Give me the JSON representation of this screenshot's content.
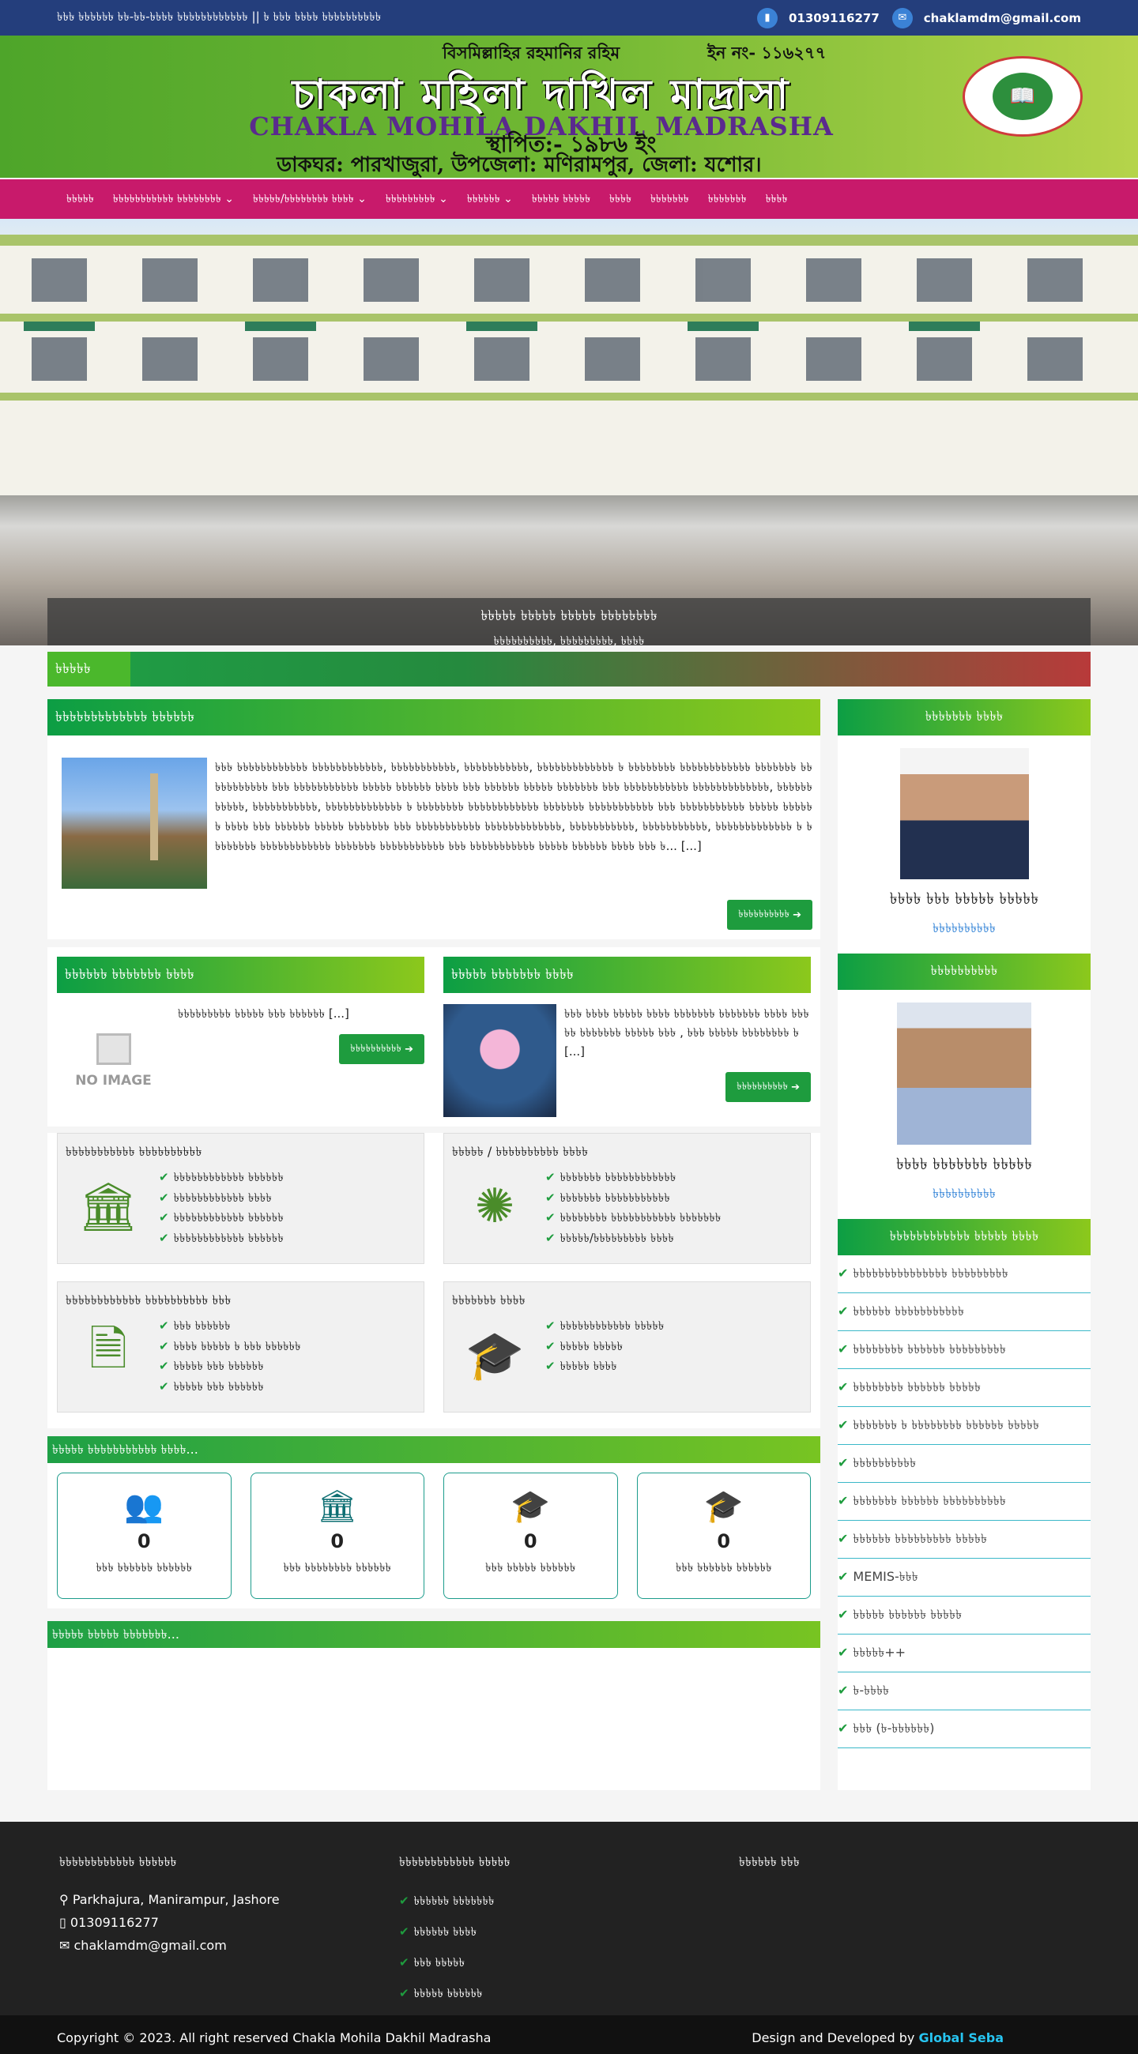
{
  "topbar": {
    "marquee": "৳৳৳ ৳৳৳৳৳৳ ৳৳-৳৳-৳৳৳৳ ৳৳৳৳৳৳৳৳৳৳৳৳ || ৳ ৳৳৳ ৳৳৳৳ ৳৳৳৳৳৳৳৳৳৳",
    "phone": "01309116277",
    "email": "chaklamdm@gmail.com",
    "phone_icon": "mobile-icon",
    "email_icon": "envelope-icon"
  },
  "header": {
    "bismillah": "বিসমিল্লাহির রহমানির রহিম",
    "eiin": "ইন নং- ১১৬২৭৭",
    "name_bn": "চাকলা মহিলা দাখিল মাদ্রাসা",
    "name_en": "CHAKLA MOHILA DAKHIL MADRASHA",
    "established": "স্থাপিত:- ১৯৮৬ ইং",
    "address": "ডাকঘর: পারখাজুরা, উপজেলা: মণিরামপুর, জেলা: যশোর।"
  },
  "nav": {
    "items": [
      {
        "label": "৳৳৳৳৳",
        "dropdown": false
      },
      {
        "label": "৳৳৳৳৳৳৳৳৳৳৳ ৳৳৳৳৳৳৳৳",
        "dropdown": true
      },
      {
        "label": "৳৳৳৳৳/৳৳৳৳৳৳৳৳ ৳৳৳৳",
        "dropdown": true
      },
      {
        "label": "৳৳৳৳৳৳৳৳৳",
        "dropdown": true
      },
      {
        "label": "৳৳৳৳৳৳",
        "dropdown": true
      },
      {
        "label": "৳৳৳৳৳ ৳৳৳৳৳",
        "dropdown": false
      },
      {
        "label": "৳৳৳৳",
        "dropdown": false
      },
      {
        "label": "৳৳৳৳৳৳৳",
        "dropdown": false
      },
      {
        "label": "৳৳৳৳৳৳৳",
        "dropdown": false
      },
      {
        "label": "৳৳৳৳",
        "dropdown": false
      }
    ]
  },
  "banner": {
    "caption_title": "৳৳৳৳৳ ৳৳৳৳৳ ৳৳৳৳৳ ৳৳৳৳৳৳৳৳",
    "caption_sub": "৳৳৳৳৳৳৳৳৳৳, ৳৳৳৳৳৳৳৳৳, ৳৳৳৳"
  },
  "notice": {
    "label": "৳৳৳৳৳"
  },
  "intro": {
    "title": "৳৳৳৳৳৳৳৳৳৳৳৳৳ ৳৳৳৳৳৳",
    "text": "৳৳৳ ৳৳৳৳৳৳৳৳৳৳৳৳ ৳৳৳৳৳৳৳৳৳৳৳৳, ৳৳৳৳৳৳৳৳৳৳৳, ৳৳৳৳৳৳৳৳৳৳৳, ৳৳৳৳৳৳৳৳৳৳৳৳৳ ৳ ৳৳৳৳৳৳৳৳ ৳৳৳৳৳৳৳৳৳৳৳৳ ৳৳৳৳৳৳৳ ৳৳৳৳৳৳৳৳৳৳৳ ৳৳৳ ৳৳৳৳৳৳৳৳৳৳৳ ৳৳৳৳৳ ৳৳৳৳৳৳ ৳৳৳৳ ৳৳৳ ৳৳৳৳৳৳ ৳৳৳৳৳ ৳৳৳৳৳৳৳ ৳৳৳ ৳৳৳৳৳৳৳৳৳৳৳ ৳৳৳৳৳৳৳৳৳৳৳৳৳, ৳৳৳৳৳৳৳৳৳৳৳, ৳৳৳৳৳৳৳৳৳৳৳, ৳৳৳৳৳৳৳৳৳৳৳৳৳ ৳ ৳৳৳৳৳৳৳৳ ৳৳৳৳৳৳৳৳৳৳৳৳ ৳৳৳৳৳৳৳ ৳৳৳৳৳৳৳৳৳৳৳ ৳৳৳ ৳৳৳৳৳৳৳৳৳৳৳ ৳৳৳৳৳ ৳৳৳৳৳৳ ৳৳৳৳ ৳৳৳ ৳৳৳৳৳৳ ৳৳৳৳৳ ৳৳৳৳৳৳৳ ৳৳৳ ৳৳৳৳৳৳৳৳৳৳৳ ৳৳৳৳৳৳৳৳৳৳৳৳৳, ৳৳৳৳৳৳৳৳৳৳৳, ৳৳৳৳৳৳৳৳৳৳৳, ৳৳৳৳৳৳৳৳৳৳৳৳৳ ৳ ৳৳৳৳৳৳৳৳ ৳৳৳৳৳৳৳৳৳৳৳৳ ৳৳৳৳৳৳৳ ৳৳৳৳৳৳৳৳৳৳৳ ৳৳৳ ৳৳৳৳৳৳৳৳৳৳৳ ৳৳৳৳৳ ৳৳৳৳৳৳ ৳৳৳৳ ৳৳৳ ৳... [...]",
    "more": "৳৳৳৳৳৳৳৳৳৳"
  },
  "chair_msg": {
    "title": "৳৳৳৳৳৳ ৳৳৳৳৳৳৳ ৳৳৳৳",
    "text": "৳৳৳৳৳৳৳৳৳ ৳৳৳৳৳ ৳৳৳ ৳৳৳৳৳৳ [...]",
    "no_image": "NO IMAGE",
    "more": "৳৳৳৳৳৳৳৳৳৳"
  },
  "head_msg": {
    "title": "৳৳৳৳৳ ৳৳৳৳৳৳৳ ৳৳৳৳",
    "text": "৳৳৳ ৳৳৳৳ ৳৳৳৳৳ ৳৳৳৳ ৳৳৳৳৳৳৳ ৳৳৳৳৳৳৳ ৳৳৳৳ ৳৳৳৳৳ ৳৳৳৳৳৳৳ ৳৳৳৳৳ ৳৳৳ , ৳৳৳ ৳৳৳৳৳ ৳৳৳৳৳৳৳৳ ৳ [...]",
    "more": "৳৳৳৳৳৳৳৳৳৳"
  },
  "boxes": [
    {
      "title": "৳৳৳৳৳৳৳৳৳৳৳ ৳৳৳৳৳৳৳৳৳৳",
      "icon": "institution-icon",
      "items": [
        "৳৳৳৳৳৳৳৳৳৳৳৳ ৳৳৳৳৳৳",
        "৳৳৳৳৳৳৳৳৳৳৳৳ ৳৳৳৳",
        "৳৳৳৳৳৳৳৳৳৳৳৳ ৳৳৳৳৳৳",
        "৳৳৳৳৳৳৳৳৳৳৳৳ ৳৳৳৳৳৳"
      ]
    },
    {
      "title": "৳৳৳৳৳ / ৳৳৳৳৳৳৳৳৳৳ ৳৳৳৳",
      "icon": "colorful-burst-icon",
      "items": [
        "৳৳৳৳৳৳৳ ৳৳৳৳৳৳৳৳৳৳৳৳",
        "৳৳৳৳৳৳৳ ৳৳৳৳৳৳৳৳৳৳৳",
        "৳৳৳৳৳৳৳৳ ৳৳৳৳৳৳৳৳৳৳৳ ৳৳৳৳৳৳৳",
        "৳৳৳৳৳/৳৳৳৳৳৳৳৳৳ ৳৳৳৳"
      ]
    },
    {
      "title": "৳৳৳৳৳৳৳৳৳৳৳৳ ৳৳৳৳৳৳৳৳৳৳ ৳৳৳",
      "icon": "documents-icon",
      "items": [
        "৳৳৳ ৳৳৳৳৳৳",
        "৳৳৳৳ ৳৳৳৳৳ ৳ ৳৳৳ ৳৳৳৳৳৳",
        "৳৳৳৳৳ ৳৳৳ ৳৳৳৳৳৳",
        "৳৳৳৳৳ ৳৳৳ ৳৳৳৳৳৳"
      ]
    },
    {
      "title": "৳৳৳৳৳৳৳ ৳৳৳৳",
      "icon": "graduation-cap-icon",
      "items": [
        "৳৳৳৳৳৳৳৳৳৳৳৳ ৳৳৳৳৳",
        "৳৳৳৳৳ ৳৳৳৳৳",
        "৳৳৳৳৳ ৳৳৳৳"
      ]
    }
  ],
  "stats": {
    "title": "৳৳৳৳৳ ৳৳৳৳৳৳৳৳৳৳৳ ৳৳৳৳...",
    "items": [
      {
        "icon": "users-icon",
        "value": "0",
        "label": "৳৳৳ ৳৳৳৳৳৳ ৳৳৳৳৳৳"
      },
      {
        "icon": "bank-icon",
        "value": "0",
        "label": "৳৳৳ ৳৳৳৳৳৳৳৳ ৳৳৳৳৳৳"
      },
      {
        "icon": "graduate-icon",
        "value": "0",
        "label": "৳৳৳ ৳৳৳৳৳ ৳৳৳৳৳৳"
      },
      {
        "icon": "graduate-icon",
        "value": "0",
        "label": "৳৳৳ ৳৳৳৳৳৳ ৳৳৳৳৳৳"
      }
    ]
  },
  "gallery": {
    "title": "৳৳৳৳৳ ৳৳৳৳৳ ৳৳৳৳৳৳৳..."
  },
  "sidebar": {
    "chair": {
      "title": "৳৳৳৳৳৳৳ ৳৳৳৳",
      "name": "৳৳৳৳ ৳৳৳ ৳৳৳৳৳ ৳৳৳৳৳",
      "designation": "৳৳৳৳৳৳৳৳৳৳"
    },
    "head": {
      "title": "৳৳৳৳৳৳৳৳৳৳",
      "name": "৳৳৳৳ ৳৳৳৳৳৳৳ ৳৳৳৳৳",
      "designation": "৳৳৳৳৳৳৳৳৳৳"
    },
    "links_title": "৳৳৳৳৳৳৳৳৳৳৳৳ ৳৳৳৳৳ ৳৳৳৳",
    "links": [
      "৳৳৳৳৳৳৳৳৳৳৳৳৳৳৳ ৳৳৳৳৳৳৳৳৳",
      "৳৳৳৳৳৳ ৳৳৳৳৳৳৳৳৳৳৳",
      "৳৳৳৳৳৳৳৳ ৳৳৳৳৳৳ ৳৳৳৳৳৳৳৳৳",
      "৳৳৳৳৳৳৳৳ ৳৳৳৳৳৳ ৳৳৳৳৳",
      "৳৳৳৳৳৳৳ ৳ ৳৳৳৳৳৳৳৳ ৳৳৳৳৳৳ ৳৳৳৳৳",
      "৳৳৳৳৳৳৳৳৳৳",
      "৳৳৳৳৳৳৳ ৳৳৳৳৳৳ ৳৳৳৳৳৳৳৳৳৳",
      "৳৳৳৳৳৳ ৳৳৳৳৳৳৳৳৳ ৳৳৳৳৳",
      "MEMIS-৳৳৳",
      "৳৳৳৳৳ ৳৳৳৳৳৳ ৳৳৳৳৳",
      "৳৳৳৳৳++",
      "৳-৳৳৳৳",
      "৳৳৳ (৳-৳৳৳৳৳৳)"
    ]
  },
  "footer": {
    "contact_title": "৳৳৳৳৳৳৳৳৳৳৳৳ ৳৳৳৳৳৳",
    "address": "Parkhajura, Manirampur, Jashore",
    "phone": "01309116277",
    "email": "chaklamdm@gmail.com",
    "links_title": "৳৳৳৳৳৳৳৳৳৳৳৳ ৳৳৳৳৳",
    "links": [
      "৳৳৳৳৳৳ ৳৳৳৳৳৳৳",
      "৳৳৳৳৳৳ ৳৳৳৳",
      "৳৳৳ ৳৳৳৳৳",
      "৳৳৳৳৳ ৳৳৳৳৳৳"
    ],
    "social_title": "৳৳৳৳৳৳ ৳৳৳",
    "copyright": "Copyright © 2023. All right reserved Chakla Mohila Dakhil Madrasha",
    "dev_prefix": "Design and Developed by",
    "dev_name": "Global Seba"
  }
}
